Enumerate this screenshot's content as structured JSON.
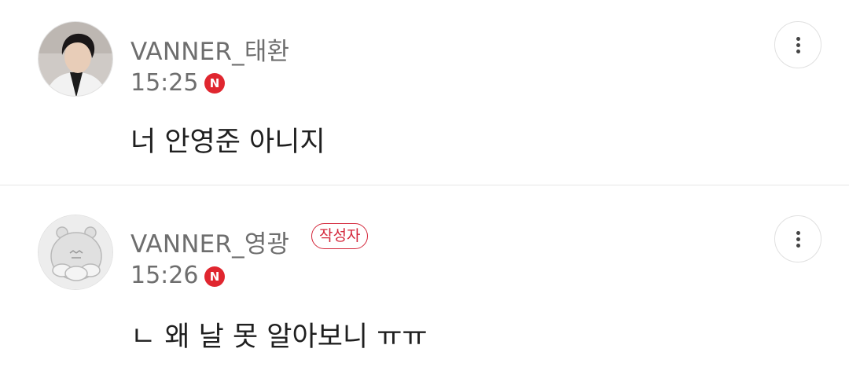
{
  "comments": [
    {
      "username": "VANNER_태환",
      "time": "15:25",
      "new_badge": "N",
      "text": "너 안영준 아니지",
      "avatar_icon": "user-photo-avatar",
      "more_icon": "more-vertical-icon"
    },
    {
      "username": "VANNER_영광",
      "author_badge": "작성자",
      "time": "15:26",
      "new_badge": "N",
      "text": "ㄴ 왜 날 못 알아보니 ㅠㅠ",
      "avatar_icon": "default-hamster-avatar",
      "more_icon": "more-vertical-icon"
    }
  ],
  "colors": {
    "meta_text": "#6e6e6e",
    "new_badge": "#e0262f",
    "author_badge": "#d4263a",
    "divider": "#e6e6e6"
  }
}
